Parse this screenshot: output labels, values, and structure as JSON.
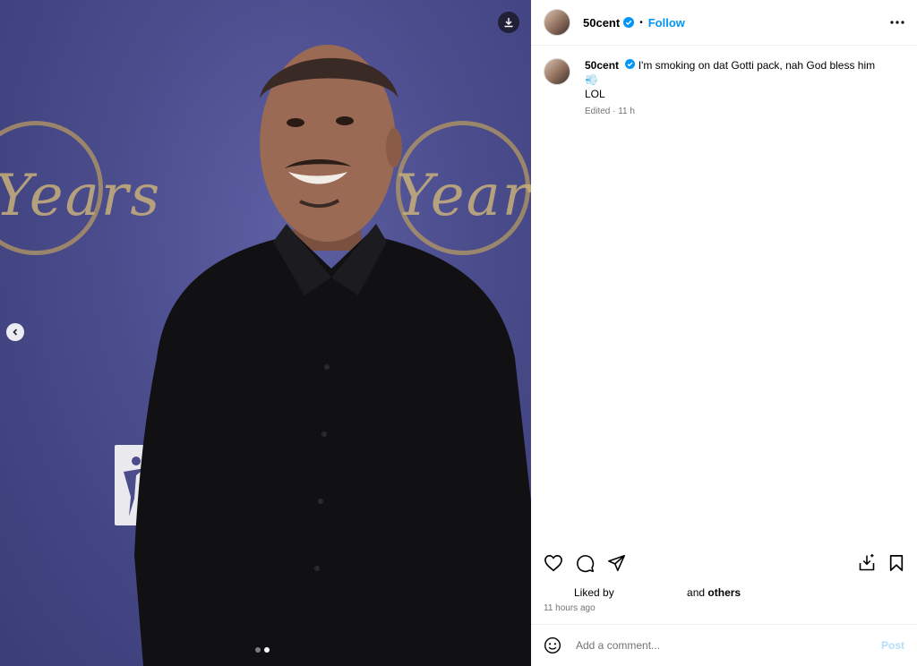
{
  "post": {
    "username": "50cent",
    "follow_label": "Follow",
    "separator": "•",
    "caption": "I'm smoking on dat Gotti pack, nah God bless him",
    "caption_line2": "LOL",
    "edited_label": "Edited · 11 h",
    "liked_by_label": "Liked by",
    "and_label": "and",
    "others_label": "others",
    "time_ago": "11 hours ago"
  },
  "comment": {
    "placeholder": "Add a comment...",
    "post_label": "Post"
  },
  "media": {
    "backdrop_word_left": "Years",
    "backdrop_word_right": "Years",
    "carousel_dots": 2,
    "active_dot": 2
  },
  "colors": {
    "link_blue": "#0095f6",
    "backdrop_purple": "#4a4c8c",
    "muted": "#737373"
  },
  "icons": [
    "download-icon",
    "chevron-left-icon",
    "verified-badge-icon",
    "more-icon",
    "heart-icon",
    "comment-icon",
    "share-icon",
    "save-to-collection-icon",
    "bookmark-icon",
    "emoji-icon"
  ]
}
